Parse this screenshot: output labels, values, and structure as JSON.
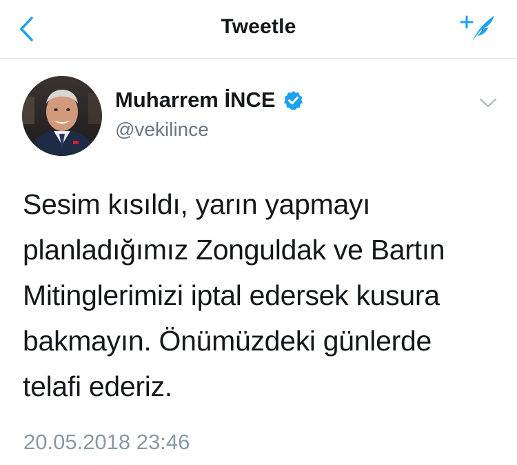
{
  "navbar": {
    "title": "Tweetle",
    "back_icon": "chevron-left-icon",
    "compose_icon": "compose-tweet-icon",
    "accent_color": "#1da1f2"
  },
  "tweet": {
    "author_name": "Muharrem İNCE",
    "verified": true,
    "verified_icon": "verified-badge-icon",
    "handle": "@vekilince",
    "menu_icon": "chevron-down-icon",
    "text_lines": [
      "Sesim kısıldı, yarın yapmayı",
      "planladığımız Zonguldak ve Bartın",
      "Mitinglerimizi iptal edersek kusura",
      "bakmayın. Önümüzdeki günlerde",
      "telafi ederiz."
    ],
    "timestamp": "20.05.2018 23:46"
  }
}
